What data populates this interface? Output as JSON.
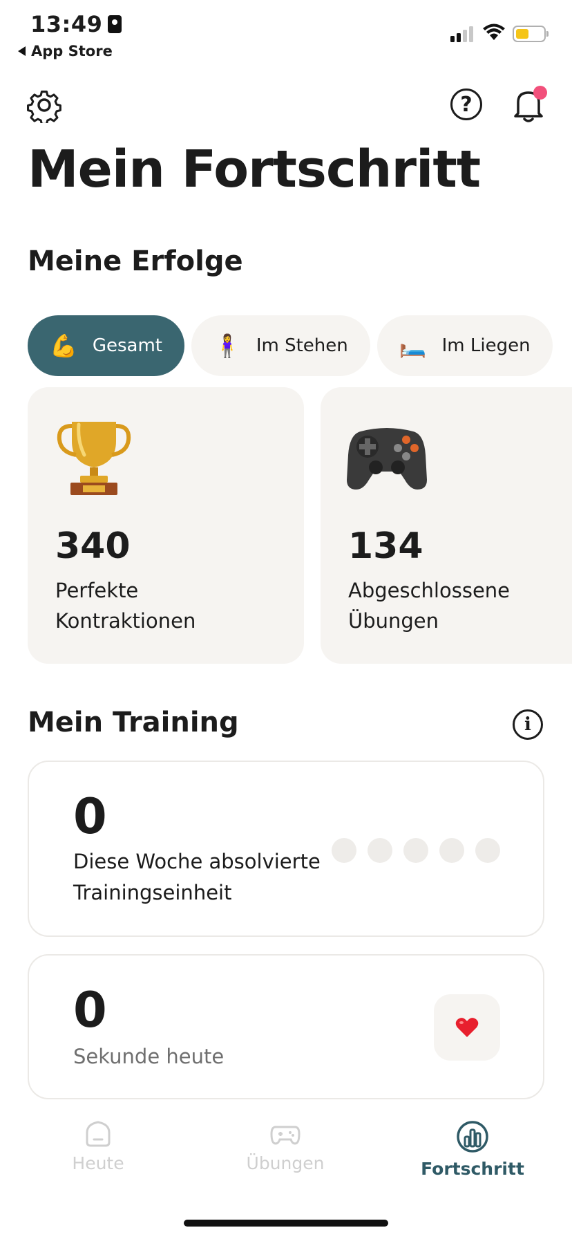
{
  "status_bar": {
    "time": "13:49",
    "back_app": "App Store",
    "battery_color": "#f5c518"
  },
  "header": {
    "title": "Mein Fortschritt",
    "icons": [
      "gear-icon",
      "help-icon",
      "bell-icon"
    ],
    "bell_badge_color": "#f2507b"
  },
  "achievements": {
    "title": "Meine Erfolge",
    "tabs": [
      {
        "emoji": "💪",
        "label": "Gesamt",
        "active": true
      },
      {
        "emoji": "🧍‍♀️",
        "label": "Im Stehen",
        "active": false
      },
      {
        "emoji": "🛏️",
        "label": "Im Liegen",
        "active": false
      }
    ],
    "cards": [
      {
        "emoji": "🏆",
        "value": "340",
        "label_line1": "Perfekte",
        "label_line2": "Kontraktionen"
      },
      {
        "emoji": "🎮",
        "value": "134",
        "label_line1": "Abgeschlossene",
        "label_line2": "Übungen"
      }
    ]
  },
  "training": {
    "title": "Mein Training",
    "week": {
      "value": "0",
      "label_line1": "Diese Woche absolvierte",
      "label_line2": "Trainingseinheit",
      "sessions_completed": 0,
      "sessions_total": 5
    },
    "seconds": {
      "value": "0",
      "label": "Sekunde heute",
      "emoji": "❤️"
    }
  },
  "bottom_nav": {
    "items": [
      {
        "label": "Heute",
        "icon": "home-icon",
        "active": false
      },
      {
        "label": "Übungen",
        "icon": "gamepad-icon",
        "active": false
      },
      {
        "label": "Fortschritt",
        "icon": "chart-icon",
        "active": true
      }
    ]
  },
  "colors": {
    "accent": "#3a6670",
    "card_bg": "#f6f4f1",
    "nav_active": "#2f5a66"
  }
}
